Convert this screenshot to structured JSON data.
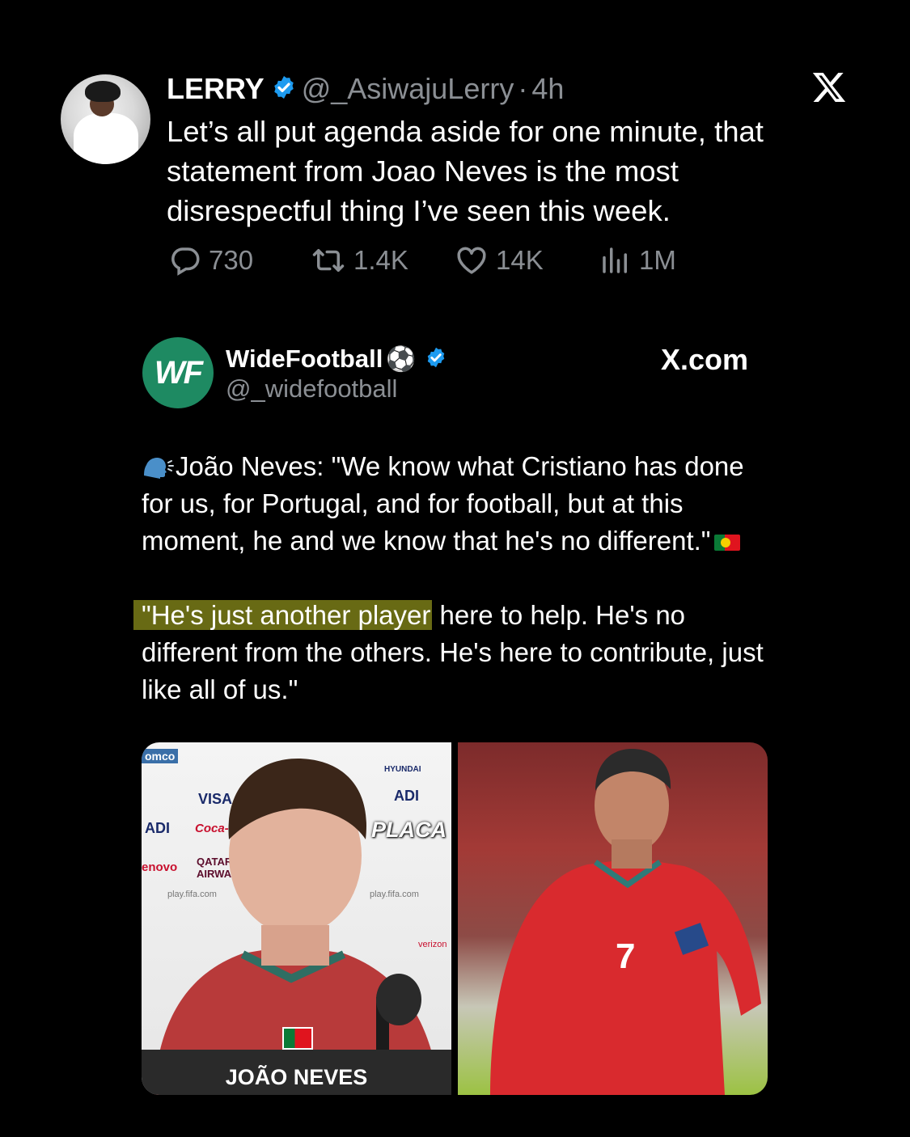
{
  "tweet": {
    "author_name": "LERRY",
    "handle": "@_AsiwajuLerry",
    "separator": "·",
    "time": "4h",
    "text": "Let’s all put agenda aside for one minute, that statement from Joao Neves is the most disrespectful thing I’ve seen this week.",
    "stats": {
      "replies": "730",
      "reposts": "1.4K",
      "likes": "14K",
      "views": "1M"
    }
  },
  "brand": "X",
  "quoted": {
    "avatar_text": "WF",
    "name": "WideFootball",
    "name_emoji": "⚽",
    "handle": "@_widefootball",
    "site": "X.com",
    "paragraph1": "João Neves: \"We know what Cristiano has done for us, for Portugal, and for football, but at this moment, he and we know that he's no different.\"",
    "highlight": "\"He's just another player",
    "paragraph2_rest": " here to help. He's no different from the others. He's here to contribute, just like all of us.\"",
    "image_left": {
      "caption": "JOÃO NEVES",
      "overlay_text": "PLACA",
      "sponsors": [
        "omco",
        "VISA",
        "ADI",
        "Coca-Cola",
        "enovo",
        "QATAR AIRWAYS",
        "HYUNDAI",
        "ADI",
        "play.fifa.com",
        "play.fifa.com",
        "verizon"
      ]
    },
    "image_right": {
      "shirt_number": "7"
    }
  },
  "colors": {
    "background": "#000000",
    "verified": "#1d9bf0",
    "highlight": "#686a14",
    "wf_green": "#1e8a62",
    "muted": "#8b8f94"
  }
}
